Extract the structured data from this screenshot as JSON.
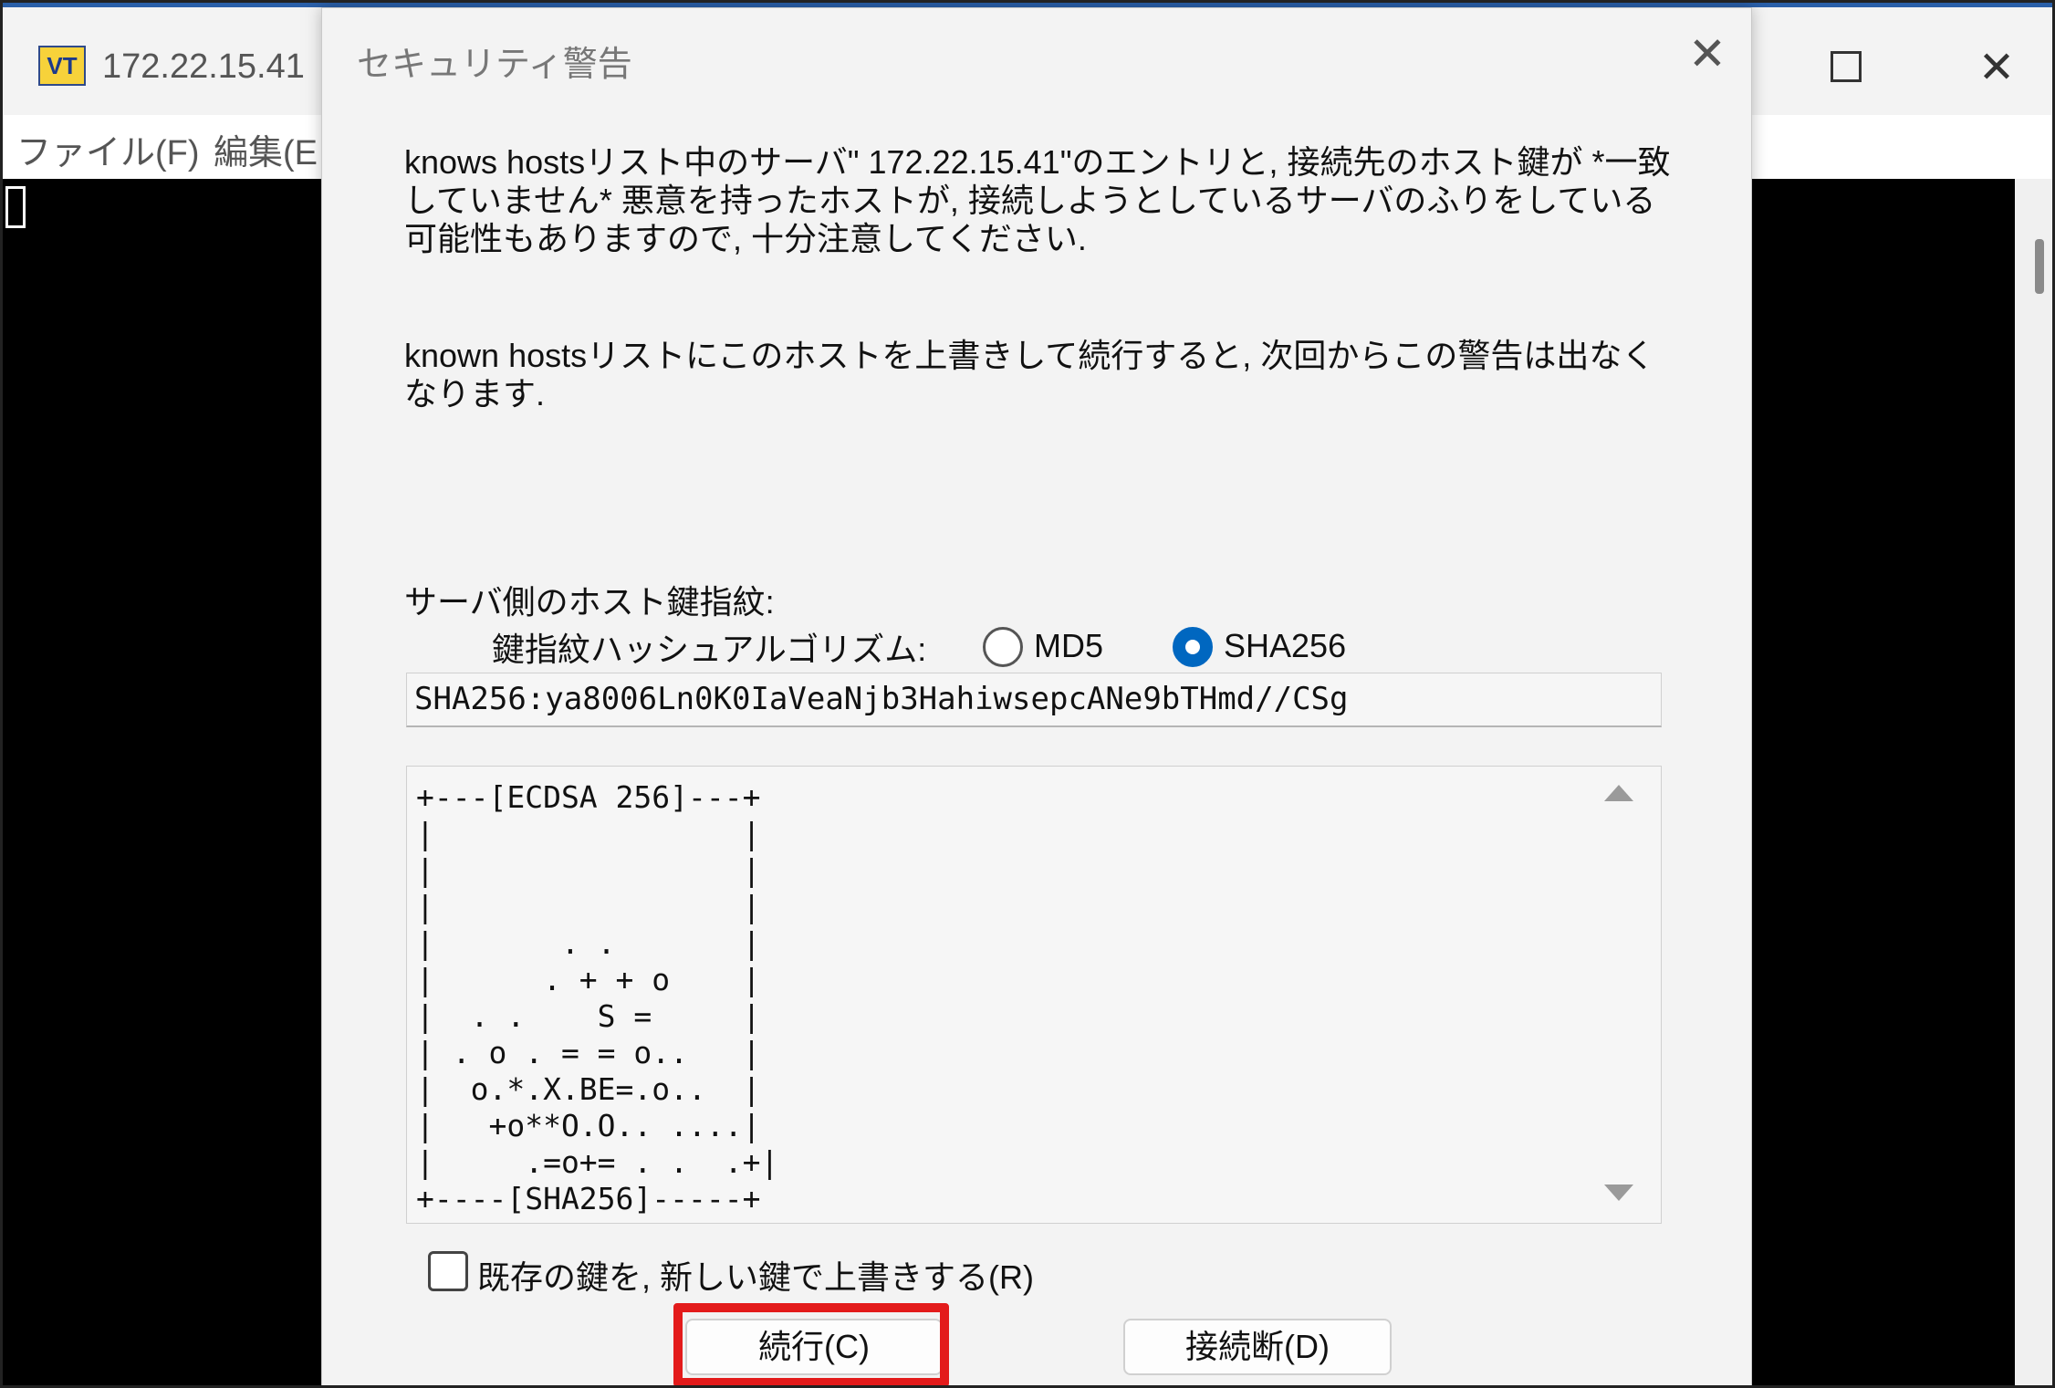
{
  "background_window": {
    "title": "172.22.15.41",
    "app_icon_text": "VT",
    "menu": [
      "ファイル(F)",
      "編集(E"
    ]
  },
  "dialog": {
    "title": "セキュリティ警告",
    "message1": "knows hostsリスト中のサーバ\" 172.22.15.41\"のエントリと, 接続先のホスト鍵が *一致していません* 悪意を持ったホストが, 接続しようとしているサーバのふりをしている可能性もありますので, 十分注意してください.",
    "message2": "known hostsリストにこのホストを上書きして続行すると, 次回からこの警告は出なくなります.",
    "fingerprint_label": "サーバ側のホスト鍵指紋:",
    "hash_algorithm_label": "鍵指紋ハッシュアルゴリズム:",
    "radio_md5": "MD5",
    "radio_sha256": "SHA256",
    "selected_algorithm": "SHA256",
    "fingerprint_value": "SHA256:ya8006Ln0K0IaVeaNjb3HahiwsepcANe9bTHmd//CSg",
    "randomart": "+---[ECDSA 256]---+\n|                 |\n|                 |\n|                 |\n|       . .       |\n|      . + + o    |\n|  . .    S =     |\n| . o . = = o..   |\n|  o.*.X.BE=.o..  |\n|   +o**O.O.. ....|\n|     .=o+= . .  .+|\n+----[SHA256]-----+",
    "overwrite_checkbox_label": "既存の鍵を, 新しい鍵で上書きする(R)",
    "overwrite_checked": false,
    "continue_button": "続行(C)",
    "disconnect_button": "接続断(D)"
  },
  "colors": {
    "accent_radio": "#0067c0",
    "highlight_box": "#e31b1b",
    "terminal_bg": "#000000"
  },
  "icons": [
    "close-icon",
    "maximize-icon",
    "scroll-up-icon",
    "scroll-down-icon"
  ]
}
